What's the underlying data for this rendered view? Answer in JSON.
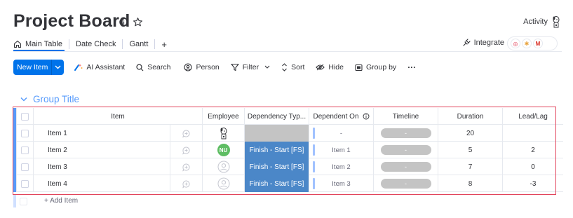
{
  "header": {
    "title": "Project Board",
    "activity_label": "Activity"
  },
  "tabs": [
    {
      "label": "Main Table",
      "icon": "home-icon",
      "active": true
    },
    {
      "label": "Date Check"
    },
    {
      "label": "Gantt"
    }
  ],
  "tabs_add": "+",
  "integrate_label": "Integrate",
  "toolbar": {
    "new_item": "New Item",
    "ai_assistant": "AI Assistant",
    "search": "Search",
    "person": "Person",
    "filter": "Filter",
    "sort": "Sort",
    "hide": "Hide",
    "group_by": "Group by",
    "more": "···"
  },
  "group": {
    "title": "Group Title",
    "color": "#579bfc"
  },
  "table": {
    "columns": [
      "Item",
      "Employee",
      "Dependency Typ...",
      "Dependent On",
      "Timeline",
      "Duration",
      "Lead/Lag"
    ],
    "rows": [
      {
        "item": "Item 1",
        "employee": "animal-avatar",
        "dependency_type": "",
        "dependent_on": "-",
        "timeline": "-",
        "duration": "20",
        "lead_lag": ""
      },
      {
        "item": "Item 2",
        "employee": "NU",
        "dependency_type": "Finish - Start [FS]",
        "dependent_on": "Item 1",
        "timeline": "-",
        "duration": "5",
        "lead_lag": "2"
      },
      {
        "item": "Item 3",
        "employee": "",
        "dependency_type": "Finish - Start [FS]",
        "dependent_on": "Item 2",
        "timeline": "-",
        "duration": "7",
        "lead_lag": "0"
      },
      {
        "item": "Item 4",
        "employee": "",
        "dependency_type": "Finish - Start [FS]",
        "dependent_on": "Item 3",
        "timeline": "-",
        "duration": "8",
        "lead_lag": "-3"
      }
    ],
    "add_item": "+ Add Item"
  },
  "colors": {
    "accent": "#0073ea",
    "status_blue": "#4b87c8",
    "highlight_frame": "#e2445c"
  }
}
